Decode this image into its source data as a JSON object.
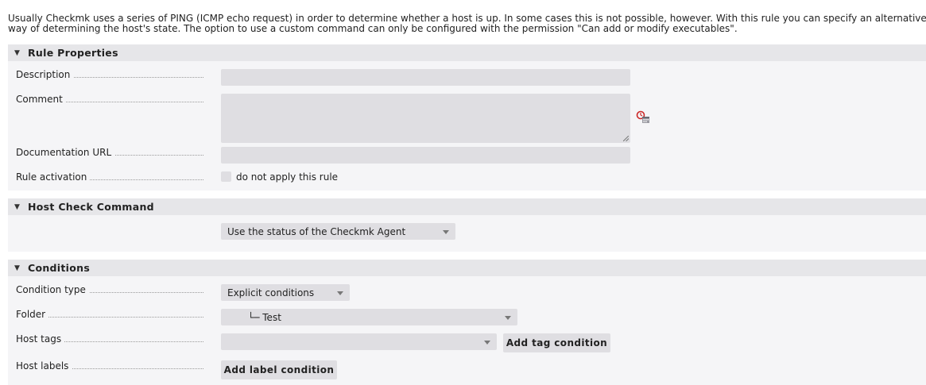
{
  "intro_text": "Usually Checkmk uses a series of PING (ICMP echo request) in order to determine whether a host is up. In some cases this is not possible, however. With this rule you can specify an alternative way of determining the host's state. The option to use a custom command can only be configured with the permission \"Can add or modify executables\".",
  "rule_properties": {
    "title": "Rule Properties",
    "description_label": "Description",
    "description_value": "",
    "comment_label": "Comment",
    "comment_value": "",
    "doc_url_label": "Documentation URL",
    "doc_url_value": "",
    "activation_label": "Rule activation",
    "activation_checkbox_label": "do not apply this rule"
  },
  "host_check_command": {
    "title": "Host Check Command",
    "selected": "Use the status of the Checkmk Agent"
  },
  "conditions": {
    "title": "Conditions",
    "condition_type_label": "Condition type",
    "condition_type_value": "Explicit conditions",
    "folder_label": "Folder",
    "folder_value": "└─ Test",
    "host_tags_label": "Host tags",
    "host_tags_value": "",
    "add_tag_button": "Add tag condition",
    "host_labels_label": "Host labels",
    "add_label_button": "Add label condition"
  },
  "icons": {
    "section_toggle": "triangle-down-icon",
    "comment_timestamp": "timestamp-icon"
  },
  "colors": {
    "field_bg": "#dfdee2",
    "section_header_bg": "#e6e6e9",
    "section_body_bg": "#f5f5f7",
    "icon_red": "#cc2a2a"
  }
}
